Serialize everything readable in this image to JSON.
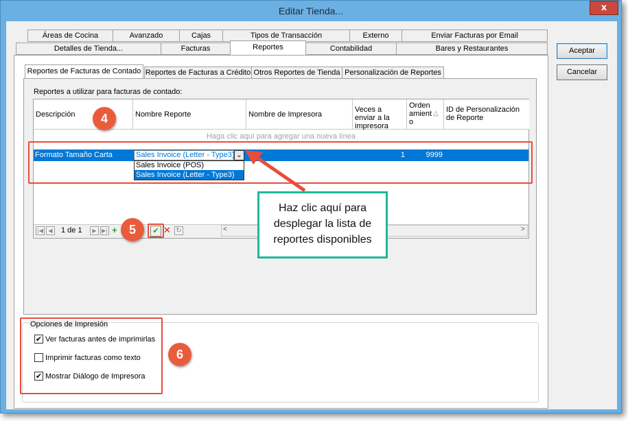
{
  "window": {
    "title": "Editar Tienda...",
    "close_glyph": "x"
  },
  "tabs_row1": [
    "Áreas de Cocina",
    "Avanzado",
    "Cajas",
    "Tipos de Transacción",
    "Externo",
    "Enviar Facturas por Email"
  ],
  "tabs_row2": [
    "Detalles de Tienda...",
    "Facturas",
    "Reportes",
    "Contabilidad",
    "Bares y Restaurantes"
  ],
  "selected_tab": "Reportes",
  "subtabs": [
    "Reportes de Facturas de Contado",
    "Reportes de Facturas a Crédito",
    "Otros Reportes de Tienda",
    "Personalización de Reportes"
  ],
  "section_label": "Reportes a utilizar para facturas de contado:",
  "grid": {
    "headers": [
      "Descripción",
      "Nombre Reporte",
      "Nombre de Impresora",
      "Veces a enviar a la impresora",
      "Orden amient o",
      "ID de Personalización de Reporte"
    ],
    "add_row_text": "Haga clic aquí para agregar una nueva línea",
    "row": {
      "descripcion": "Formato Tamaño Carta",
      "reporte": "Sales Invoice (Letter - Type3)",
      "veces": "1",
      "orden": "9999"
    },
    "dropdown_options": [
      "Sales Invoice (POS)",
      "Sales Invoice (Letter - Type3)"
    ],
    "pager": "1 de 1"
  },
  "callout": "Haz clic aquí para desplegar la lista de reportes disponibles",
  "badges": [
    "4",
    "5",
    "6"
  ],
  "print_options": {
    "legend": "Opciones de Impresión",
    "items": [
      {
        "label": "Ver facturas antes de imprimirlas",
        "checked": true
      },
      {
        "label": "Imprimir facturas como texto",
        "checked": false
      },
      {
        "label": "Mostrar Diálogo de Impresora",
        "checked": true
      }
    ]
  },
  "buttons": {
    "accept": "Aceptar",
    "cancel": "Cancelar"
  },
  "colors": {
    "title_bar": "#6ab0e3",
    "selection": "#0078d7",
    "annotation_red": "#e84c3d",
    "callout_border": "#1fb79a"
  }
}
